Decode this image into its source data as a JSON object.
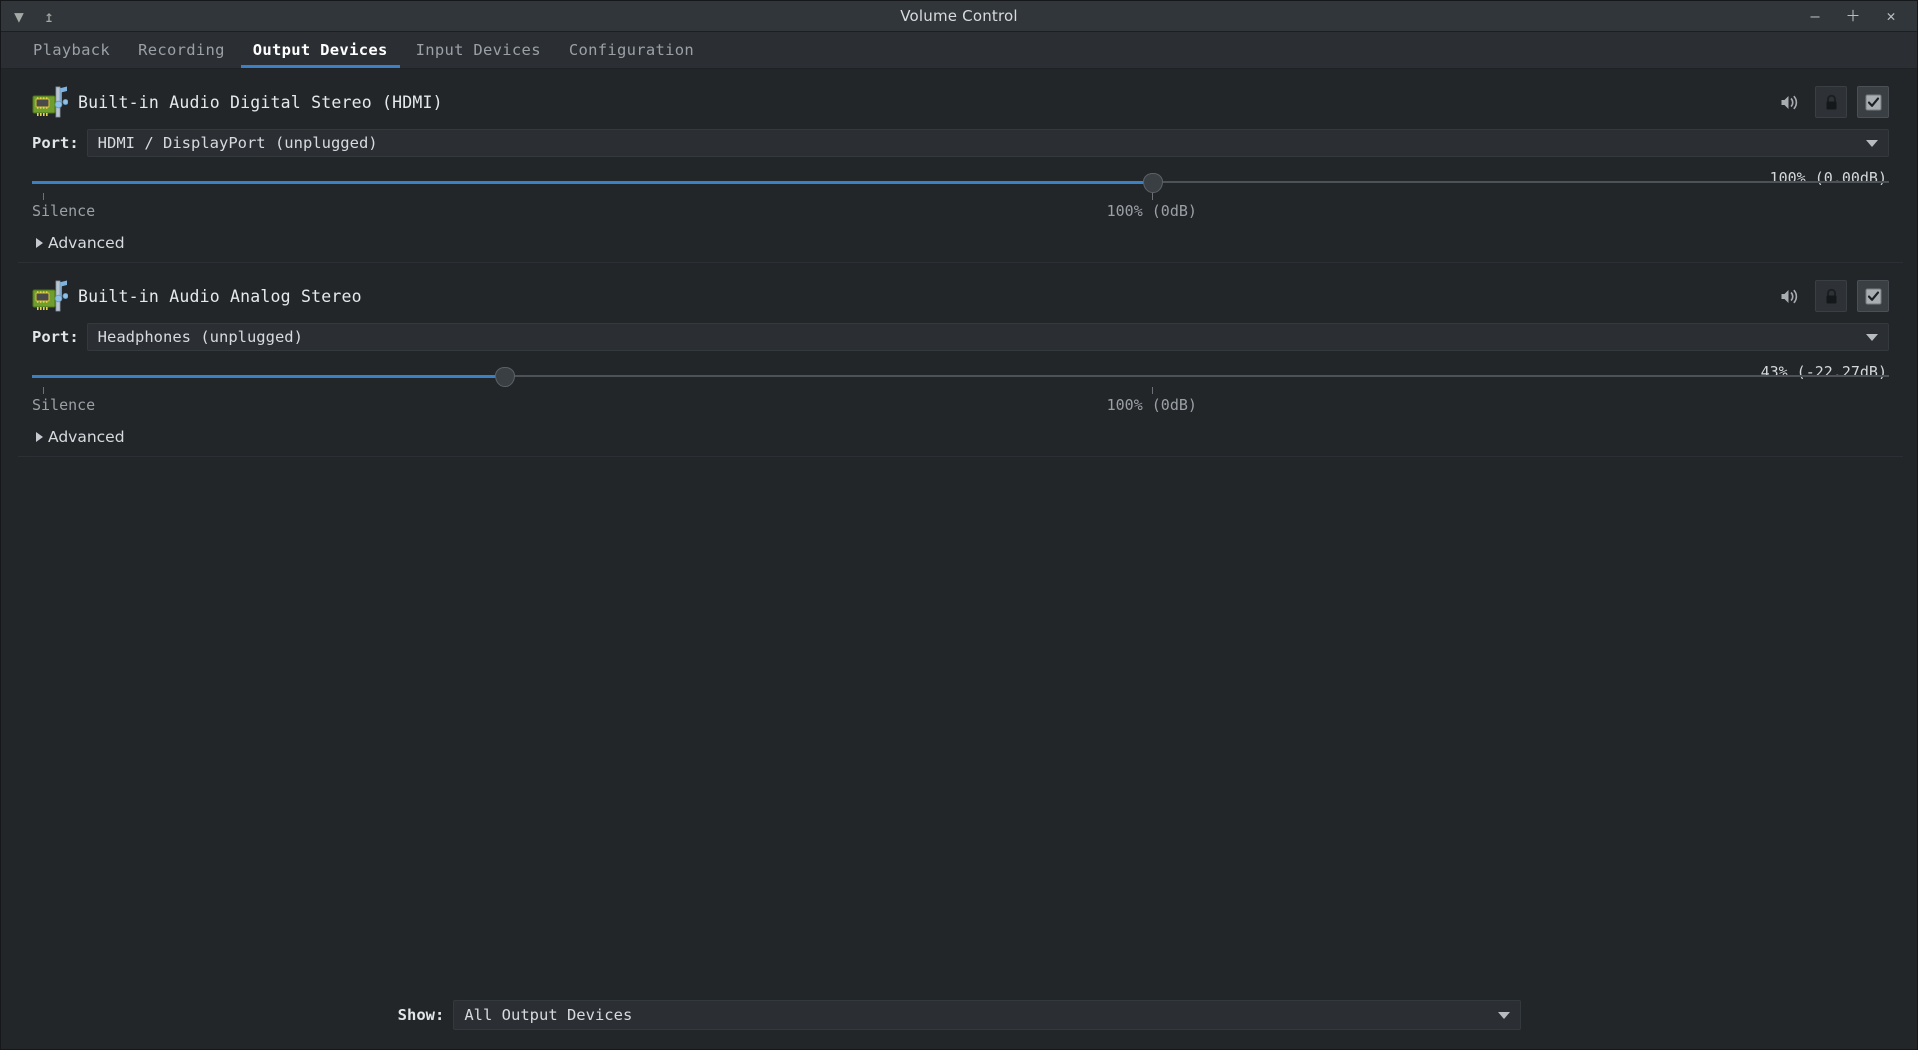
{
  "window": {
    "title": "Volume Control",
    "left_icons": [
      {
        "name": "menu-triangle-icon",
        "glyph": "▼"
      },
      {
        "name": "pin-icon",
        "glyph": "↥"
      }
    ],
    "controls": [
      {
        "name": "minimize-button",
        "glyph": "–"
      },
      {
        "name": "maximize-button",
        "glyph": "＋"
      },
      {
        "name": "close-button",
        "glyph": "✕"
      }
    ]
  },
  "tabs": [
    {
      "label": "Playback",
      "active": false
    },
    {
      "label": "Recording",
      "active": false
    },
    {
      "label": "Output Devices",
      "active": true
    },
    {
      "label": "Input Devices",
      "active": false
    },
    {
      "label": "Configuration",
      "active": false
    }
  ],
  "devices": [
    {
      "title": "Built-in Audio Digital Stereo (HDMI)",
      "icon": "sound-card-icon",
      "mute_icon": "speaker-volume-icon",
      "lock_icon": "lock-channels-icon",
      "default_icon": "default-device-check-icon",
      "default_checked": true,
      "port_label": "Port:",
      "port_value": "HDMI / DisplayPort (unplugged)",
      "volume_readout": "100% (0.00dB)",
      "volume_percent": 100,
      "handle_position_pct": 60.3,
      "fill_pct": 60.3,
      "ticks": [
        {
          "label": "Silence",
          "pos_pct": 0.6
        },
        {
          "label": "100% (0dB)",
          "pos_pct": 60.3
        }
      ],
      "advanced_label": "Advanced"
    },
    {
      "title": "Built-in Audio Analog Stereo",
      "icon": "sound-card-icon",
      "mute_icon": "speaker-volume-icon",
      "lock_icon": "lock-channels-icon",
      "default_icon": "default-device-check-icon",
      "default_checked": true,
      "port_label": "Port:",
      "port_value": "Headphones (unplugged)",
      "volume_readout": "43% (-22.27dB)",
      "volume_percent": 43,
      "handle_position_pct": 25.4,
      "fill_pct": 25.4,
      "ticks": [
        {
          "label": "Silence",
          "pos_pct": 0.6
        },
        {
          "label": "100% (0dB)",
          "pos_pct": 60.3
        }
      ],
      "advanced_label": "Advanced"
    }
  ],
  "footer": {
    "show_label": "Show:",
    "show_value": "All Output Devices"
  },
  "colors": {
    "accent": "#3b7fc4",
    "window_bg": "#232629",
    "titlebar_bg": "#31363b",
    "tabbar_bg": "#2b2f33"
  }
}
